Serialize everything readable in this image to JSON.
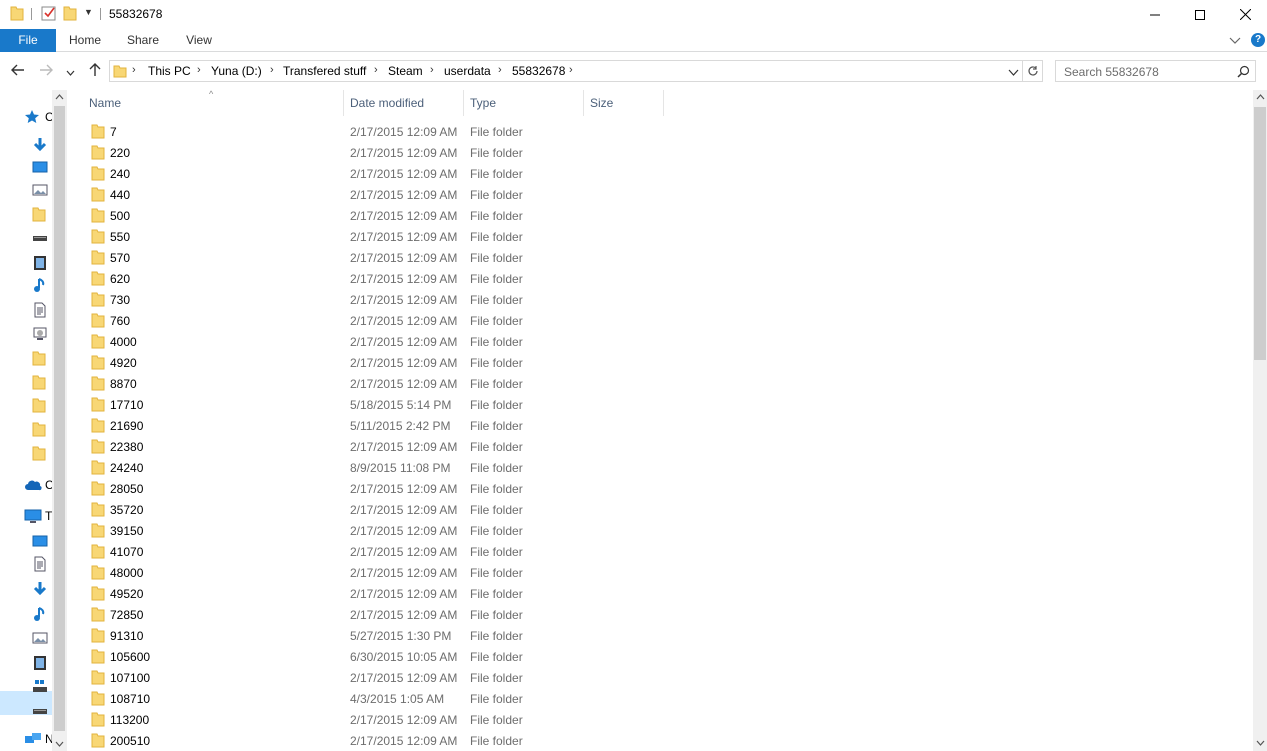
{
  "window": {
    "title": "55832678"
  },
  "ribbon": {
    "tabs": [
      "File",
      "Home",
      "Share",
      "View"
    ]
  },
  "address": {
    "crumbs": [
      "This PC",
      "Yuna (D:)",
      "Transfered stuff",
      "Steam",
      "userdata",
      "55832678"
    ]
  },
  "search": {
    "placeholder": "Search 55832678"
  },
  "columns": {
    "name": "Name",
    "date": "Date modified",
    "type": "Type",
    "size": "Size"
  },
  "navpane": {
    "items": [
      {
        "icon": "quick-access-star-icon",
        "caret": "C"
      },
      {
        "icon": "downloads-arrow-icon"
      },
      {
        "icon": "desktop-icon"
      },
      {
        "icon": "pictures-icon"
      },
      {
        "icon": "folder-icon"
      },
      {
        "icon": "drive-icon"
      },
      {
        "icon": "videos-icon"
      },
      {
        "icon": "music-note-icon"
      },
      {
        "icon": "documents-icon"
      },
      {
        "icon": "network-share-icon"
      },
      {
        "icon": "folder-icon"
      },
      {
        "icon": "folder-icon"
      },
      {
        "icon": "folder-icon"
      },
      {
        "icon": "folder-icon"
      },
      {
        "icon": "folder-icon"
      },
      {
        "icon": "onedrive-cloud-icon",
        "caret": "C"
      },
      {
        "icon": "this-pc-icon",
        "caret": "T"
      },
      {
        "icon": "desktop-icon"
      },
      {
        "icon": "documents-icon"
      },
      {
        "icon": "downloads-arrow-icon"
      },
      {
        "icon": "music-note-icon"
      },
      {
        "icon": "pictures-icon"
      },
      {
        "icon": "videos-icon"
      },
      {
        "icon": "windows-drive-icon"
      },
      {
        "icon": "drive-icon"
      },
      {
        "icon": "network-icon",
        "caret": "N"
      }
    ]
  },
  "files": [
    {
      "name": "7",
      "date": "2/17/2015 12:09 AM",
      "type": "File folder"
    },
    {
      "name": "220",
      "date": "2/17/2015 12:09 AM",
      "type": "File folder"
    },
    {
      "name": "240",
      "date": "2/17/2015 12:09 AM",
      "type": "File folder"
    },
    {
      "name": "440",
      "date": "2/17/2015 12:09 AM",
      "type": "File folder"
    },
    {
      "name": "500",
      "date": "2/17/2015 12:09 AM",
      "type": "File folder"
    },
    {
      "name": "550",
      "date": "2/17/2015 12:09 AM",
      "type": "File folder"
    },
    {
      "name": "570",
      "date": "2/17/2015 12:09 AM",
      "type": "File folder"
    },
    {
      "name": "620",
      "date": "2/17/2015 12:09 AM",
      "type": "File folder"
    },
    {
      "name": "730",
      "date": "2/17/2015 12:09 AM",
      "type": "File folder"
    },
    {
      "name": "760",
      "date": "2/17/2015 12:09 AM",
      "type": "File folder"
    },
    {
      "name": "4000",
      "date": "2/17/2015 12:09 AM",
      "type": "File folder"
    },
    {
      "name": "4920",
      "date": "2/17/2015 12:09 AM",
      "type": "File folder"
    },
    {
      "name": "8870",
      "date": "2/17/2015 12:09 AM",
      "type": "File folder"
    },
    {
      "name": "17710",
      "date": "5/18/2015 5:14 PM",
      "type": "File folder"
    },
    {
      "name": "21690",
      "date": "5/11/2015 2:42 PM",
      "type": "File folder"
    },
    {
      "name": "22380",
      "date": "2/17/2015 12:09 AM",
      "type": "File folder"
    },
    {
      "name": "24240",
      "date": "8/9/2015 11:08 PM",
      "type": "File folder"
    },
    {
      "name": "28050",
      "date": "2/17/2015 12:09 AM",
      "type": "File folder"
    },
    {
      "name": "35720",
      "date": "2/17/2015 12:09 AM",
      "type": "File folder"
    },
    {
      "name": "39150",
      "date": "2/17/2015 12:09 AM",
      "type": "File folder"
    },
    {
      "name": "41070",
      "date": "2/17/2015 12:09 AM",
      "type": "File folder"
    },
    {
      "name": "48000",
      "date": "2/17/2015 12:09 AM",
      "type": "File folder"
    },
    {
      "name": "49520",
      "date": "2/17/2015 12:09 AM",
      "type": "File folder"
    },
    {
      "name": "72850",
      "date": "2/17/2015 12:09 AM",
      "type": "File folder"
    },
    {
      "name": "91310",
      "date": "5/27/2015 1:30 PM",
      "type": "File folder"
    },
    {
      "name": "105600",
      "date": "6/30/2015 10:05 AM",
      "type": "File folder"
    },
    {
      "name": "107100",
      "date": "2/17/2015 12:09 AM",
      "type": "File folder"
    },
    {
      "name": "108710",
      "date": "4/3/2015 1:05 AM",
      "type": "File folder"
    },
    {
      "name": "113200",
      "date": "2/17/2015 12:09 AM",
      "type": "File folder"
    },
    {
      "name": "200510",
      "date": "2/17/2015 12:09 AM",
      "type": "File folder"
    }
  ],
  "colors": {
    "accent": "#1979ca",
    "folder": "#f8d775",
    "folder_dark": "#e2b33d",
    "selection": "#cce8ff"
  }
}
